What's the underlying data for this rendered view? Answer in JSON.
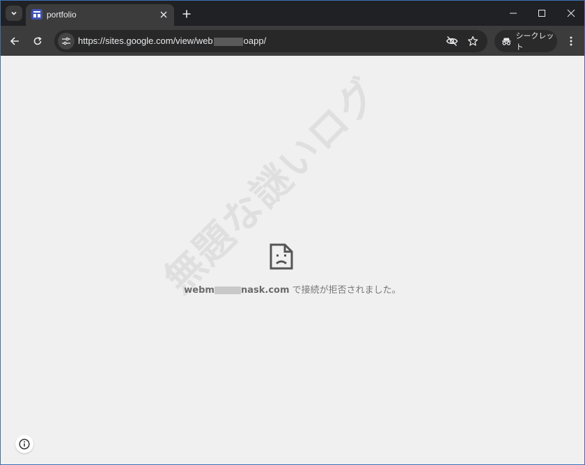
{
  "tab": {
    "title": "portfolio"
  },
  "omnibox": {
    "url_prefix": "https://sites.google.com/view/web",
    "url_suffix": "oapp/"
  },
  "incognito": {
    "label": "シークレット"
  },
  "error": {
    "host_prefix": "webm",
    "host_suffix": "nask.com",
    "message": "で接続が拒否されました。"
  },
  "watermark": "無題な謎いログ",
  "icons": {
    "tab_search": "chevron-down-icon",
    "favicon": "sites-favicon",
    "tab_close": "close-icon",
    "new_tab": "plus-icon",
    "minimize": "minimize-icon",
    "maximize": "maximize-icon",
    "close": "close-icon",
    "back": "back-arrow-icon",
    "reload": "reload-icon",
    "site_info": "tune-icon",
    "tracking": "eye-off-icon",
    "bookmark": "star-icon",
    "incognito": "incognito-icon",
    "menu": "more-vert-icon",
    "error": "sad-page-icon",
    "info": "info-icon"
  }
}
